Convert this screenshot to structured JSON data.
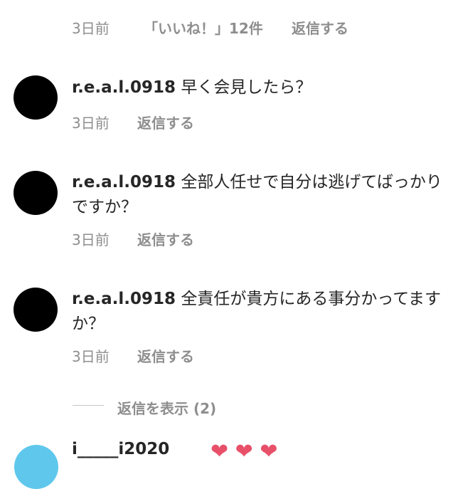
{
  "top_row": {
    "time": "3日前",
    "likes": "「いいね！」12件",
    "reply": "返信する"
  },
  "replies": [
    {
      "user": "r.e.a.l.0918",
      "text": "早く会見したら？",
      "time": "3日前",
      "reply": "返信する"
    },
    {
      "user": "r.e.a.l.0918",
      "text": "全部人任せで自分は逃げてばっかりですか？",
      "time": "3日前",
      "reply": "返信する"
    },
    {
      "user": "r.e.a.l.0918",
      "text": "全責任が貴方にある事分かってますか？",
      "time": "3日前",
      "reply": "返信する"
    }
  ],
  "view_replies": "返信を表示 (2)",
  "next_comment": {
    "user": "i_____i2020",
    "hearts": "❤ ❤ ❤"
  }
}
